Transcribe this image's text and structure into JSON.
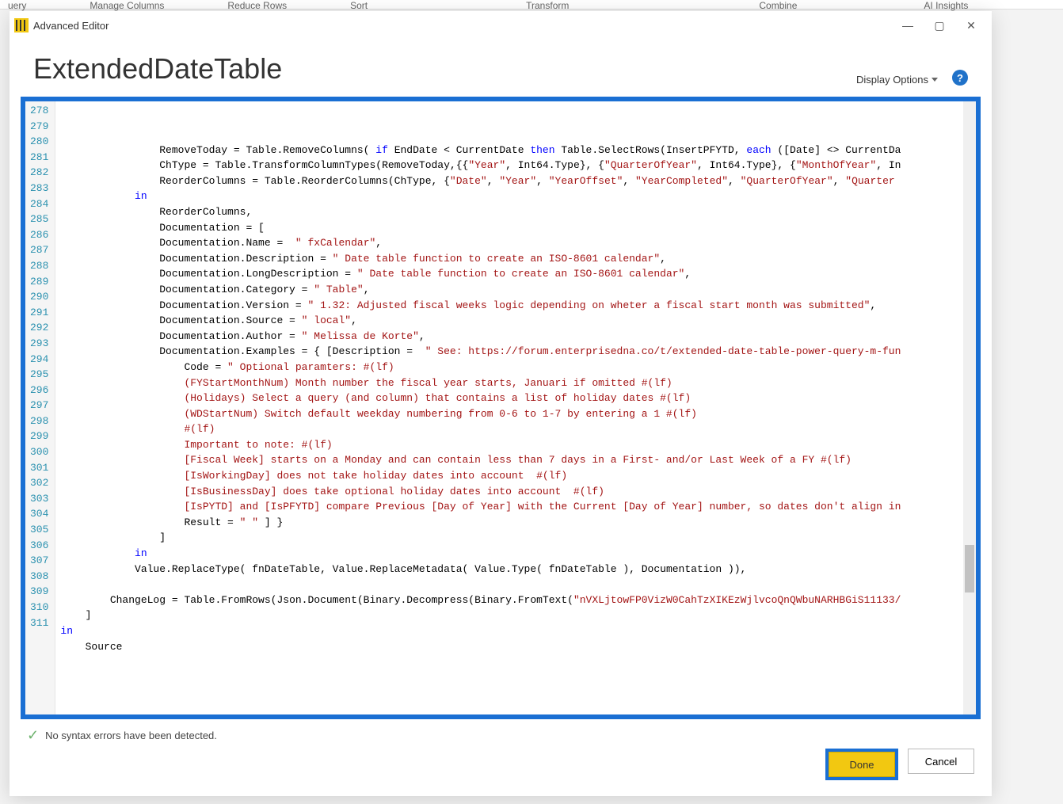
{
  "ribbon": {
    "tabs": [
      "uery",
      "Manage Columns",
      "Reduce Rows",
      "Sort",
      "Transform",
      "Combine",
      "AI Insights"
    ]
  },
  "titlebar": {
    "title": "Advanced Editor"
  },
  "header": {
    "title": "ExtendedDateTable",
    "display_options": "Display Options",
    "help_glyph": "?"
  },
  "editor": {
    "first_line_num": 278,
    "lines": [
      {
        "indent": 16,
        "segments": []
      },
      {
        "indent": 16,
        "segments": [
          [
            "id",
            "RemoveToday = Table.RemoveColumns( "
          ],
          [
            "kw",
            "if"
          ],
          [
            "id",
            " EndDate < CurrentDate "
          ],
          [
            "kw",
            "then"
          ],
          [
            "id",
            " Table.SelectRows(InsertPFYTD, "
          ],
          [
            "kw",
            "each"
          ],
          [
            "id",
            " ([Date] <> CurrentDa"
          ]
        ]
      },
      {
        "indent": 16,
        "segments": [
          [
            "id",
            "ChType = Table.TransformColumnTypes(RemoveToday,{{"
          ],
          [
            "str",
            "\"Year\""
          ],
          [
            "id",
            ", Int64.Type}, {"
          ],
          [
            "str",
            "\"QuarterOfYear\""
          ],
          [
            "id",
            ", Int64.Type}, {"
          ],
          [
            "str",
            "\"MonthOfYear\""
          ],
          [
            "id",
            ", In"
          ]
        ]
      },
      {
        "indent": 16,
        "segments": [
          [
            "id",
            "ReorderColumns = Table.ReorderColumns(ChType, {"
          ],
          [
            "str",
            "\"Date\""
          ],
          [
            "id",
            ", "
          ],
          [
            "str",
            "\"Year\""
          ],
          [
            "id",
            ", "
          ],
          [
            "str",
            "\"YearOffset\""
          ],
          [
            "id",
            ", "
          ],
          [
            "str",
            "\"YearCompleted\""
          ],
          [
            "id",
            ", "
          ],
          [
            "str",
            "\"QuarterOfYear\""
          ],
          [
            "id",
            ", "
          ],
          [
            "str",
            "\"Quarter"
          ]
        ]
      },
      {
        "indent": 12,
        "segments": [
          [
            "kw",
            "in"
          ]
        ]
      },
      {
        "indent": 16,
        "segments": [
          [
            "id",
            "ReorderColumns,"
          ]
        ]
      },
      {
        "indent": 16,
        "segments": [
          [
            "id",
            "Documentation = ["
          ]
        ]
      },
      {
        "indent": 16,
        "segments": [
          [
            "id",
            "Documentation.Name =  "
          ],
          [
            "str",
            "\" fxCalendar\""
          ],
          [
            "id",
            ","
          ]
        ]
      },
      {
        "indent": 16,
        "segments": [
          [
            "id",
            "Documentation.Description = "
          ],
          [
            "str",
            "\" Date table function to create an ISO-8601 calendar\""
          ],
          [
            "id",
            ","
          ]
        ]
      },
      {
        "indent": 16,
        "segments": [
          [
            "id",
            "Documentation.LongDescription = "
          ],
          [
            "str",
            "\" Date table function to create an ISO-8601 calendar\""
          ],
          [
            "id",
            ","
          ]
        ]
      },
      {
        "indent": 16,
        "segments": [
          [
            "id",
            "Documentation.Category = "
          ],
          [
            "str",
            "\" Table\""
          ],
          [
            "id",
            ","
          ]
        ]
      },
      {
        "indent": 16,
        "segments": [
          [
            "id",
            "Documentation.Version = "
          ],
          [
            "str",
            "\" 1.32: Adjusted fiscal weeks logic depending on wheter a fiscal start month was submitted\""
          ],
          [
            "id",
            ","
          ]
        ]
      },
      {
        "indent": 16,
        "segments": [
          [
            "id",
            "Documentation.Source = "
          ],
          [
            "str",
            "\" local\""
          ],
          [
            "id",
            ","
          ]
        ]
      },
      {
        "indent": 16,
        "segments": [
          [
            "id",
            "Documentation.Author = "
          ],
          [
            "str",
            "\" Melissa de Korte\""
          ],
          [
            "id",
            ","
          ]
        ]
      },
      {
        "indent": 16,
        "segments": [
          [
            "id",
            "Documentation.Examples = { [Description =  "
          ],
          [
            "str",
            "\" See: https://forum.enterprisedna.co/t/extended-date-table-power-query-m-fun"
          ]
        ]
      },
      {
        "indent": 20,
        "segments": [
          [
            "id",
            "Code = "
          ],
          [
            "str",
            "\" Optional paramters: #(lf)"
          ]
        ]
      },
      {
        "indent": 20,
        "segments": [
          [
            "str",
            "(FYStartMonthNum) Month number the fiscal year starts, Januari if omitted #(lf)"
          ]
        ]
      },
      {
        "indent": 20,
        "segments": [
          [
            "str",
            "(Holidays) Select a query (and column) that contains a list of holiday dates #(lf)"
          ]
        ]
      },
      {
        "indent": 20,
        "segments": [
          [
            "str",
            "(WDStartNum) Switch default weekday numbering from 0-6 to 1-7 by entering a 1 #(lf)"
          ]
        ]
      },
      {
        "indent": 20,
        "segments": [
          [
            "str",
            "#(lf)"
          ]
        ]
      },
      {
        "indent": 20,
        "segments": [
          [
            "str",
            "Important to note: #(lf)"
          ]
        ]
      },
      {
        "indent": 20,
        "segments": [
          [
            "str",
            "[Fiscal Week] starts on a Monday and can contain less than 7 days in a First- and/or Last Week of a FY #(lf)"
          ]
        ]
      },
      {
        "indent": 20,
        "segments": [
          [
            "str",
            "[IsWorkingDay] does not take holiday dates into account  #(lf)"
          ]
        ]
      },
      {
        "indent": 20,
        "segments": [
          [
            "str",
            "[IsBusinessDay] does take optional holiday dates into account  #(lf)"
          ]
        ]
      },
      {
        "indent": 20,
        "segments": [
          [
            "str",
            "[IsPYTD] and [IsPFYTD] compare Previous [Day of Year] with the Current [Day of Year] number, so dates don't align in"
          ]
        ]
      },
      {
        "indent": 20,
        "segments": [
          [
            "id",
            "Result = "
          ],
          [
            "str",
            "\" \""
          ],
          [
            "id",
            " ] }"
          ]
        ]
      },
      {
        "indent": 16,
        "segments": [
          [
            "id",
            "]"
          ]
        ]
      },
      {
        "indent": 12,
        "segments": [
          [
            "kw",
            "in"
          ]
        ]
      },
      {
        "indent": 12,
        "segments": [
          [
            "id",
            "Value.ReplaceType( fnDateTable, Value.ReplaceMetadata( Value.Type( fnDateTable ), Documentation )),"
          ]
        ]
      },
      {
        "indent": 0,
        "segments": []
      },
      {
        "indent": 8,
        "segments": [
          [
            "id",
            "ChangeLog = Table.FromRows(Json.Document(Binary.Decompress(Binary.FromText("
          ],
          [
            "str",
            "\"nVXLjtowFP0VizW0CahTzXIKEzWjlvcoQnQWbuNARHBGiS11133/"
          ]
        ]
      },
      {
        "indent": 4,
        "segments": [
          [
            "id",
            "]"
          ]
        ]
      },
      {
        "indent": 0,
        "segments": [
          [
            "kw",
            "in"
          ]
        ]
      },
      {
        "indent": 4,
        "segments": [
          [
            "id",
            "Source"
          ]
        ]
      }
    ]
  },
  "status": {
    "message": "No syntax errors have been detected."
  },
  "buttons": {
    "done": "Done",
    "cancel": "Cancel"
  }
}
